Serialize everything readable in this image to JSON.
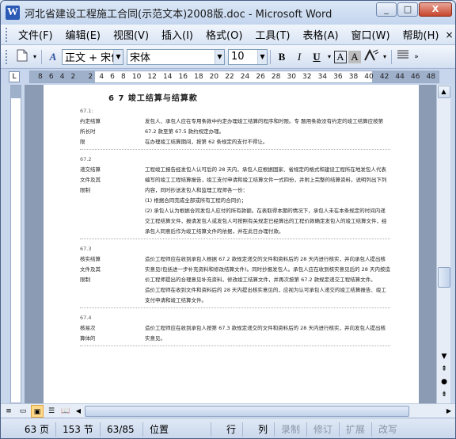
{
  "window": {
    "title": "河北省建设工程施工合同(示范文本)2008版.doc - Microsoft Word",
    "app_icon": "W",
    "minimize": "_",
    "maximize": "□",
    "close": "X"
  },
  "menu": {
    "items": [
      "文件(F)",
      "编辑(E)",
      "视图(V)",
      "插入(I)",
      "格式(O)",
      "工具(T)",
      "表格(A)",
      "窗口(W)",
      "帮助(H)"
    ],
    "close_doc": "×"
  },
  "toolbar": {
    "style_value": "正文 + 宋体",
    "font_value": "宋体",
    "size_value": "10",
    "bold": "B",
    "italic": "I",
    "underline": "U",
    "char_border": "A",
    "char_shading": "A"
  },
  "ruler": {
    "corner": "L",
    "numbers": [
      "8",
      "6",
      "4",
      "2",
      "",
      "2",
      "4",
      "6",
      "8",
      "10",
      "12",
      "14",
      "16",
      "18",
      "20",
      "22",
      "24",
      "26",
      "28",
      "30",
      "32",
      "34",
      "36",
      "38",
      "40",
      "42",
      "44",
      "46",
      "48"
    ]
  },
  "document": {
    "heading": "6 7  竣工结算与结算款",
    "articles": [
      {
        "num": "67.1:",
        "label": "约定结算\n所长时\n限",
        "body": "发包人、承包人应在专用条款中约定办理竣工结算的程序和时限。专 题用条款没有约定的竣工结算应按第 67.2 款至第 67.5 款约规定办理。\n在办理竣工结算期间，按第 62 条规定的支付不得让。"
      },
      {
        "num": "67.2",
        "label": "递交结算\n文件及其\n限制",
        "body": "工程竣工报告经发包人认可后的 28 天内，承包人应根据国家、省规定的格式和建设工程所在地发包人代表编写的竣工工程结算报告，竣工支付申请和竣工结算文件一式四份，并附上完整的结算资料，说明列出下列内容，同时抄送发包人和监理工程师各一份：\n(1) 根据合同完成全部或所有工程的合同价；\n(2) 承包人认为根据合同发包人应付的所有款额。在表取得本期的情况下，承包人未在本条规定的时间内递交工程结算文件，报请发包人或发包人可按照有关规定已经算出的工程价款确定发包人的竣工结算文件，经承包人同意后作为竣工结算文件的依据，并在此日办理付款。"
      },
      {
        "num": "67.3",
        "label": "核实结算\n文件及其\n限制",
        "body": "造价工程师应在收到承包人根据 67.2 款规定递交的文件和资料后的 28 天内进行核实，并向承包人提出核实意见(包括进一步补充资料和修改结算文件)。同时抄报发包人。承包人应在收到核实意见后的 28 天内按造价工程师提出的合理意见补充资料，修改竣工结算文件，并再次按第 67.2 款规定递交工程结算文件。\n造价工程师在收到文件和资料后的 28 天内提出核实意见的，应视为认可承包人递交的竣工结算报告、竣工支付申请和竣工结算文件。"
      },
      {
        "num": "67.4",
        "label": "核易次\n算体的",
        "body": "造价工程师应在收到承包人按第 67.3 款规定递交的文件和资料后的 28 天内进行核实，并向发包人提出核实意见。"
      }
    ]
  },
  "status": {
    "page": "63 页",
    "section": "153 节",
    "page_of": "63/85",
    "position": "位置",
    "line": "行",
    "column": "列",
    "rec": "录制",
    "trk": "修订",
    "ext": "扩展",
    "ovr": "改写"
  }
}
